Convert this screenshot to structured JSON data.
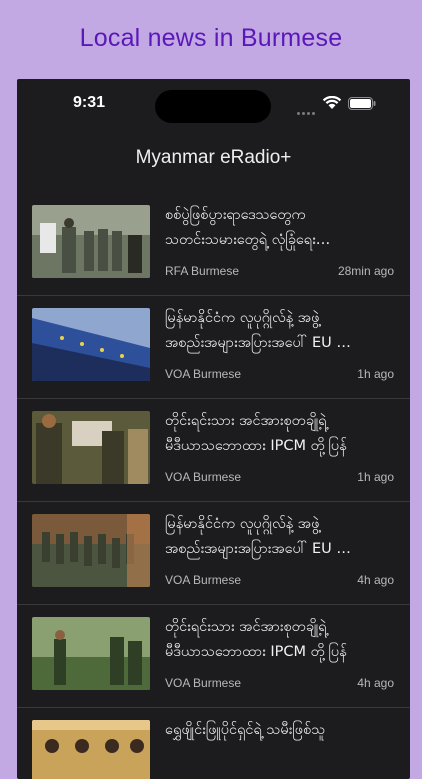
{
  "banner": {
    "text": "Local news in Burmese"
  },
  "status_bar": {
    "time": "9:31"
  },
  "app": {
    "title": "Myanmar eRadio+"
  },
  "articles": [
    {
      "line1": "စစ်ပွဲဖြစ်ပွားရာဒေသတွေက",
      "line2": "သတင်းသမားတွေရဲ့ လုံခြုံရေး…",
      "source": "RFA Burmese",
      "ago": "28min ago",
      "thumb_colors": [
        "#6d7563",
        "#4a4f44",
        "#9aa08e"
      ]
    },
    {
      "line1": "မြန်မာနိုင်ငံက လူပုဂ္ဂိုလ်နဲ့ အဖွဲ့",
      "line2": "အစည်းအများအပြားအပေါ် EU …",
      "source": "VOA Burmese",
      "ago": "1h ago",
      "thumb_colors": [
        "#2e4f9a",
        "#8fa6cf",
        "#1d2e5c"
      ]
    },
    {
      "line1": "တိုင်းရင်းသား အင်အားစုတချို့ရဲ့",
      "line2": "မီဒီယာသဘောထား IPCM တို့ပြန်",
      "source": "VOA Burmese",
      "ago": "1h ago",
      "thumb_colors": [
        "#5b5a3a",
        "#3b3a28",
        "#a08a60"
      ]
    },
    {
      "line1": "မြန်မာနိုင်ငံက လူပုဂ္ဂိုလ်နဲ့ အဖွဲ့",
      "line2": "အစည်းအများအပြားအပေါ် EU …",
      "source": "VOA Burmese",
      "ago": "4h ago",
      "thumb_colors": [
        "#7a5a3a",
        "#4b5540",
        "#c08050"
      ]
    },
    {
      "line1": "တိုင်းရင်းသား အင်အားစုတချို့ရဲ့",
      "line2": "မီဒီယာသဘောထား IPCM တို့ပြန်",
      "source": "VOA Burmese",
      "ago": "4h ago",
      "thumb_colors": [
        "#4e6a3a",
        "#2f3f25",
        "#8aa070"
      ]
    },
    {
      "line1": "ရွှေဖျိုင်းဖြူပိုင်ရှင်ရဲ့ သမီးဖြစ်သူ",
      "line2": "",
      "source": "",
      "ago": "",
      "thumb_colors": [
        "#c9a35a",
        "#7a5a30",
        "#e8c88a"
      ]
    }
  ]
}
